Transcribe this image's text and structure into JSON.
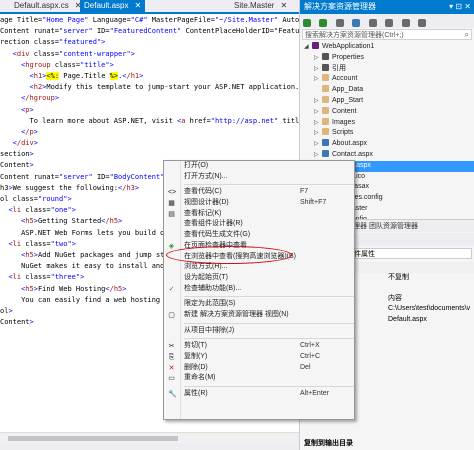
{
  "editor": {
    "tabs": [
      {
        "label": "Default.aspx.cs",
        "active": false
      },
      {
        "label": "Default.aspx",
        "active": true
      },
      {
        "label": "Site.Master",
        "active": false
      }
    ],
    "lines": [
      "age Title=\"Home Page\" Language=\"C#\" MasterPageFile=\"~/Site.Master\" AutoEventWi",
      "Content runat=\"server\" ID=\"FeaturedContent\" ContentPlaceHolderID=\"FeaturedCont",
      "rection class=\"featured\">",
      "   <div class=\"content-wrapper\">",
      "     <hgroup class=\"title\">",
      "       <h1><%: Page.Title %>.</h1>",
      "       <h2>Modify this template to jump-start your ASP.NET application.</h2>",
      "     </hgroup>",
      "     <p>",
      "       To learn more about ASP.NET, visit <a href=\"http://asp.net\" title=\"",
      "     </p>",
      "   </div>",
      "section>",
      "Content>",
      "Content runat=\"server\" ID=\"BodyContent\" ContentPlaceHolderID=\"MainContent\">",
      "h3>We suggest the following:</h3>",
      "ol class=\"round\">",
      "  <li class=\"one\">",
      "     <h5>Getting Started</h5>",
      "     ASP.NET Web Forms lets you build dynam",
      "  <li class=\"two\">",
      "     <h5>Add NuGet packages and jump start",
      "     NuGet makes it easy to install and upd",
      "  <li class=\"three\">",
      "     <h5>Find Web Hosting</h5>",
      "     You can easily find a web hosting comp",
      "ol>",
      "Content>"
    ]
  },
  "solution_explorer": {
    "title": "解决方案资源管理器",
    "title_buttons": "▾ ⊡ ✕",
    "search_placeholder": "搜索解决方案资源管理器(Ctrl+;)",
    "items": [
      {
        "label": "WebApplication1",
        "depth": 0,
        "arrow": "◢",
        "icon": "project",
        "color": "#68217a"
      },
      {
        "label": "Properties",
        "depth": 1,
        "arrow": "▷",
        "icon": "folder",
        "color": "#555"
      },
      {
        "label": "引用",
        "depth": 1,
        "arrow": "▷",
        "icon": "ref",
        "color": "#555"
      },
      {
        "label": "Account",
        "depth": 1,
        "arrow": "▷",
        "icon": "folder",
        "color": "#dcb67a"
      },
      {
        "label": "App_Data",
        "depth": 1,
        "arrow": "",
        "icon": "folder",
        "color": "#dcb67a"
      },
      {
        "label": "App_Start",
        "depth": 1,
        "arrow": "▷",
        "icon": "folder",
        "color": "#dcb67a"
      },
      {
        "label": "Content",
        "depth": 1,
        "arrow": "▷",
        "icon": "folder",
        "color": "#dcb67a"
      },
      {
        "label": "Images",
        "depth": 1,
        "arrow": "▷",
        "icon": "folder",
        "color": "#dcb67a"
      },
      {
        "label": "Scripts",
        "depth": 1,
        "arrow": "▷",
        "icon": "folder",
        "color": "#dcb67a"
      },
      {
        "label": "About.aspx",
        "depth": 1,
        "arrow": "▷",
        "icon": "page",
        "color": "#3c78b4"
      },
      {
        "label": "Contact.aspx",
        "depth": 1,
        "arrow": "▷",
        "icon": "page",
        "color": "#3c78b4"
      },
      {
        "label": "Default.aspx",
        "depth": 1,
        "arrow": "▷",
        "icon": "page",
        "color": "#3c78b4",
        "selected": true
      },
      {
        "label": "favicon.ico",
        "depth": 1,
        "arrow": "",
        "icon": "file",
        "color": "#888"
      },
      {
        "label": "Global.asax",
        "depth": 1,
        "arrow": "",
        "icon": "file",
        "color": "#888"
      },
      {
        "label": "packages.config",
        "depth": 1,
        "arrow": "",
        "icon": "file",
        "color": "#888"
      },
      {
        "label": "Site.Master",
        "depth": 1,
        "arrow": "",
        "icon": "file",
        "color": "#888"
      },
      {
        "label": "Web.config",
        "depth": 1,
        "arrow": "",
        "icon": "file",
        "color": "#888"
      }
    ],
    "bottom_tabs": "解决方案资源管理器   团队资源管理器",
    "properties_title": "属性",
    "properties_object": "文件属性",
    "properties": [
      {
        "name": "",
        "value": "",
        "category": true
      },
      {
        "name": "",
        "value": "不复制"
      },
      {
        "name": "",
        "value": ""
      },
      {
        "name": "",
        "value": "内容"
      },
      {
        "name": "",
        "value": "C:\\Users\\test\\documents\\v"
      },
      {
        "name": "",
        "value": "Default.aspx"
      },
      {
        "name": "",
        "value": ""
      },
      {
        "name": "",
        "value": ""
      },
      {
        "name": "名空间",
        "value": ""
      }
    ],
    "description_title": "复制到输出目录"
  },
  "context_menu": {
    "items": [
      {
        "label": "打开(O)",
        "shortcut": "",
        "icon": ""
      },
      {
        "label": "打开方式(N)...",
        "shortcut": "",
        "icon": ""
      },
      {
        "sep": true
      },
      {
        "label": "查看代码(C)",
        "shortcut": "F7",
        "icon": "<>"
      },
      {
        "label": "视图设计器(D)",
        "shortcut": "Shift+F7",
        "icon": "▦"
      },
      {
        "label": "查看标记(K)",
        "shortcut": "",
        "icon": "▤"
      },
      {
        "label": "查看组件设计器(R)",
        "shortcut": "",
        "icon": ""
      },
      {
        "label": "查看代码生成文件(G)",
        "shortcut": "",
        "icon": ""
      },
      {
        "label": "在页面检查器中查看",
        "shortcut": "",
        "icon": "◈"
      },
      {
        "label": "在浏览器中查看(搜狗高速浏览器)(B)",
        "shortcut": "",
        "icon": ""
      },
      {
        "label": "浏览方式(H)...",
        "shortcut": "",
        "icon": ""
      },
      {
        "label": "设为起始页(T)",
        "shortcut": "",
        "icon": ""
      },
      {
        "label": "检查辅助功能(B)...",
        "shortcut": "",
        "icon": "✓"
      },
      {
        "sep": true
      },
      {
        "label": "限定为此范围(S)",
        "shortcut": "",
        "icon": ""
      },
      {
        "label": "新建 解决方案资源管理器 视图(N)",
        "shortcut": "",
        "icon": "▢"
      },
      {
        "sep": true
      },
      {
        "label": "从项目中排除(J)",
        "shortcut": "",
        "icon": ""
      },
      {
        "sep": true
      },
      {
        "label": "剪切(T)",
        "shortcut": "Ctrl+X",
        "icon": "✂"
      },
      {
        "label": "复制(Y)",
        "shortcut": "Ctrl+C",
        "icon": "⎘"
      },
      {
        "label": "删除(D)",
        "shortcut": "Del",
        "icon": "✕"
      },
      {
        "label": "重命名(M)",
        "shortcut": "",
        "icon": "▭"
      },
      {
        "sep": true
      },
      {
        "label": "属性(R)",
        "shortcut": "Alt+Enter",
        "icon": "🔧"
      }
    ]
  },
  "colors": {
    "accent": "#007acc",
    "selection": "#3399ff",
    "annotation": "#d01010"
  }
}
